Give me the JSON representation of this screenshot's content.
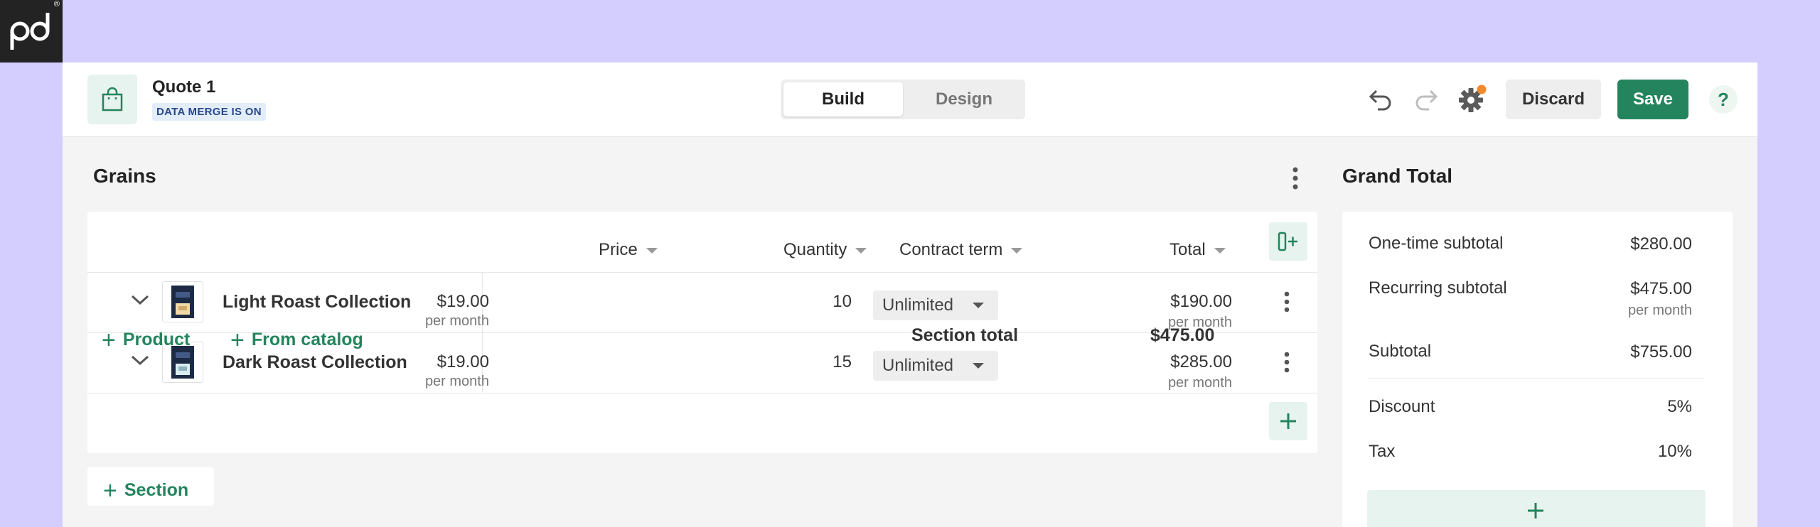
{
  "header": {
    "quote_title": "Quote 1",
    "merge_badge": "DATA MERGE IS ON",
    "tabs": [
      {
        "label": "Build",
        "active": true
      },
      {
        "label": "Design",
        "active": false
      }
    ],
    "discard_label": "Discard",
    "save_label": "Save",
    "help_label": "?",
    "accent_color": "#24845d",
    "notification_dot_color": "#f08a2c"
  },
  "section": {
    "title": "Grains",
    "columns": {
      "price": "Price",
      "quantity": "Quantity",
      "term": "Contract term",
      "total": "Total"
    },
    "rows": [
      {
        "name": "Light Roast Collection",
        "price": "$19.00",
        "price_period": "per month",
        "quantity": "10",
        "term": "Unlimited",
        "total": "$190.00",
        "total_period": "per month"
      },
      {
        "name": "Dark Roast Collection",
        "price": "$19.00",
        "price_period": "per month",
        "quantity": "15",
        "term": "Unlimited",
        "total": "$285.00",
        "total_period": "per month"
      }
    ],
    "add_product_label": "Product",
    "add_catalog_label": "From catalog",
    "section_total_label": "Section total",
    "section_total_value": "$475.00",
    "add_section_label": "Section"
  },
  "grand_total": {
    "title": "Grand Total",
    "one_time_label": "One-time subtotal",
    "one_time_value": "$280.00",
    "recurring_label": "Recurring subtotal",
    "recurring_value": "$475.00",
    "recurring_period": "per month",
    "subtotal_label": "Subtotal",
    "subtotal_value": "$755.00",
    "discount_label": "Discount",
    "discount_value": "5%",
    "tax_label": "Tax",
    "tax_value": "10%"
  }
}
